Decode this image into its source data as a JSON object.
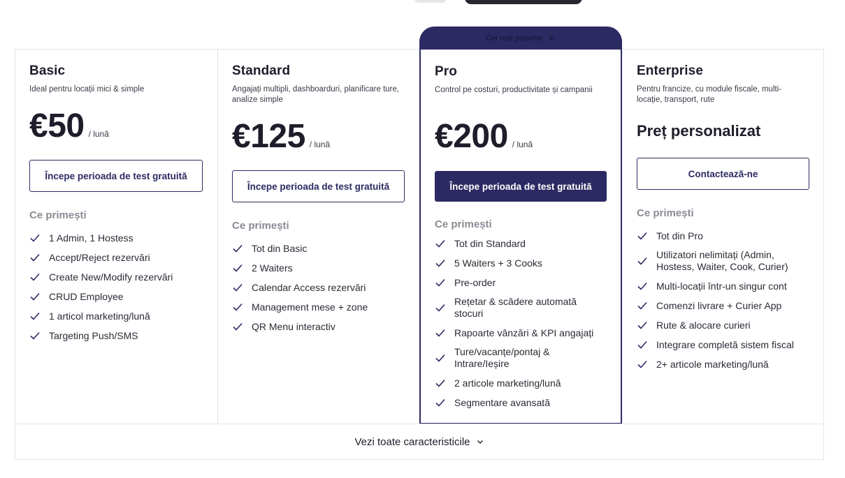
{
  "pro_badge": "Cel mai popular",
  "plans": [
    {
      "name": "Basic",
      "description": "Ideal pentru locații mici & simple",
      "price": "€50",
      "period": "/ lună",
      "cta": "Începe perioada de test gratuită",
      "features_title": "Ce primești",
      "features": [
        "1 Admin, 1 Hostess",
        "Accept/Reject rezervări",
        "Create New/Modify rezervări",
        "CRUD Employee",
        "1 articol marketing/lună",
        "Targeting Push/SMS"
      ]
    },
    {
      "name": "Standard",
      "description": "Angajați multipli, dashboarduri, planificare ture, analize simple",
      "price": "€125",
      "period": "/ lună",
      "cta": "Începe perioada de test gratuită",
      "features_title": "Ce primești",
      "features": [
        "Tot din Basic",
        "2 Waiters",
        "Calendar Access rezervări",
        "Management mese + zone",
        "QR Menu interactiv"
      ]
    },
    {
      "name": "Pro",
      "description": "Control pe costuri, productivitate și campanii",
      "price": "€200",
      "period": "/ lună",
      "cta": "Începe perioada de test gratuită",
      "features_title": "Ce primești",
      "features": [
        "Tot din Standard",
        "5 Waiters + 3 Cooks",
        "Pre-order",
        "Rețetar & scădere automată stocuri",
        "Rapoarte vânzări & KPI angajați",
        "Ture/vacanțe/pontaj & Intrare/Ieșire",
        "2 articole marketing/lună",
        "Segmentare avansată"
      ]
    },
    {
      "name": "Enterprise",
      "description": "Pentru francize, cu module fiscale, multi-locație, transport, rute",
      "price": "Preț personalizat",
      "cta": "Contactează-ne",
      "features_title": "Ce primești",
      "features": [
        "Tot din Pro",
        "Utilizatori nelimitați (Admin, Hostess, Waiter, Cook, Curier)",
        "Multi-locații într-un singur cont",
        "Comenzi livrare + Curier App",
        "Rute & alocare curieri",
        "Integrare completă sistem fiscal",
        "2+ articole marketing/lună"
      ]
    }
  ],
  "footer_link": "Vezi toate caracteristicile",
  "colors": {
    "brand": "#2c2a63",
    "muted_heading": "#8b8b95",
    "border": "#e4e4ea"
  },
  "icons": {
    "feature": "check-icon",
    "badge": "sparkle-icon",
    "footer": "chevron-down-icon"
  }
}
